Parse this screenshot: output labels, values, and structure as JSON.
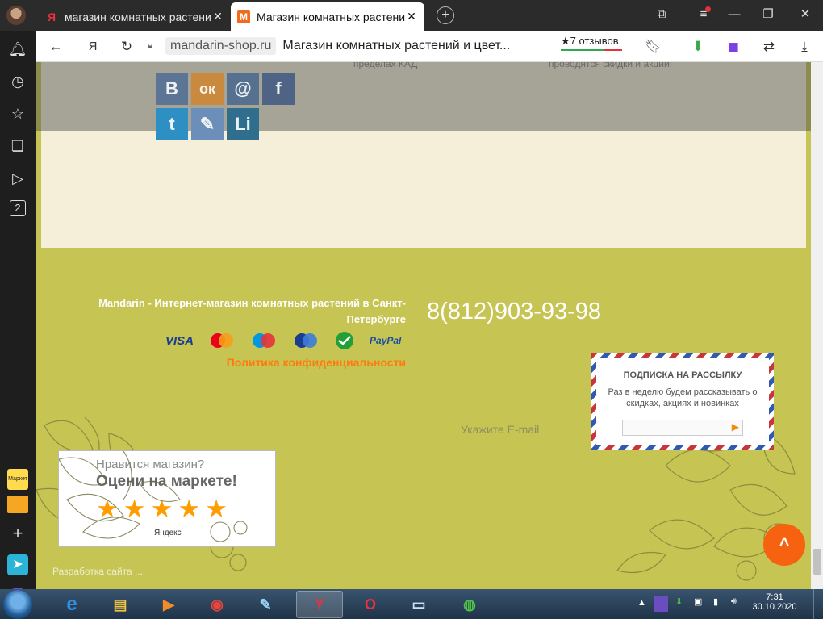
{
  "browser": {
    "tabs": [
      {
        "title": "магазин комнатных растений",
        "favicon": "Я"
      },
      {
        "title": "Магазин комнатных растений",
        "favicon": "M"
      }
    ],
    "new_tab": "+",
    "domain": "mandarin-shop.ru",
    "page_title": "Магазин комнатных растений и цвет...",
    "reviews": "★7 отзывов",
    "yandex_glyph": "Я"
  },
  "sidebar": {
    "badge": "2",
    "market": "Маркет"
  },
  "page": {
    "faded_left": "пределах КАД",
    "faded_right": "проводятся скидки и акции!",
    "social": [
      {
        "name": "vk",
        "glyph": "B",
        "color": "#4a76a8"
      },
      {
        "name": "odnoklassniki",
        "glyph": "ок",
        "color": "#ee8208"
      },
      {
        "name": "mail",
        "glyph": "@",
        "color": "#2a5aa3"
      },
      {
        "name": "facebook",
        "glyph": "f",
        "color": "#3b5998"
      },
      {
        "name": "twitter",
        "glyph": "t",
        "color": "#1da1f2"
      },
      {
        "name": "livejournal",
        "glyph": "✎",
        "color": "#5e8fc9"
      },
      {
        "name": "linkedin",
        "glyph": "Li",
        "color": "#0e76a8"
      }
    ],
    "shop_description": "Mandarin - Интернет-магазин комнатных растений в Санкт-Петербурге",
    "phone": "8(812)903-93-98",
    "payments": {
      "visa": "VISA",
      "paypal": "PayPal"
    },
    "policy": "Политика конфиденциальности",
    "subscribe": {
      "title": "ПОДПИСКА НА РАССЫЛКУ",
      "text": "Раз в неделю будем рассказывать о скидках, акциях и новинках",
      "button": "▶"
    },
    "email_placeholder": "Укажите E-mail",
    "rating": {
      "question": "Нравится магазин?",
      "call": "Оцени на маркете!",
      "stars": 5,
      "brand": "Яндекс"
    },
    "developer": "Разработка сайта ...",
    "scroll_top": "^"
  },
  "taskbar": {
    "time": "7:31",
    "date": "30.10.2020"
  }
}
